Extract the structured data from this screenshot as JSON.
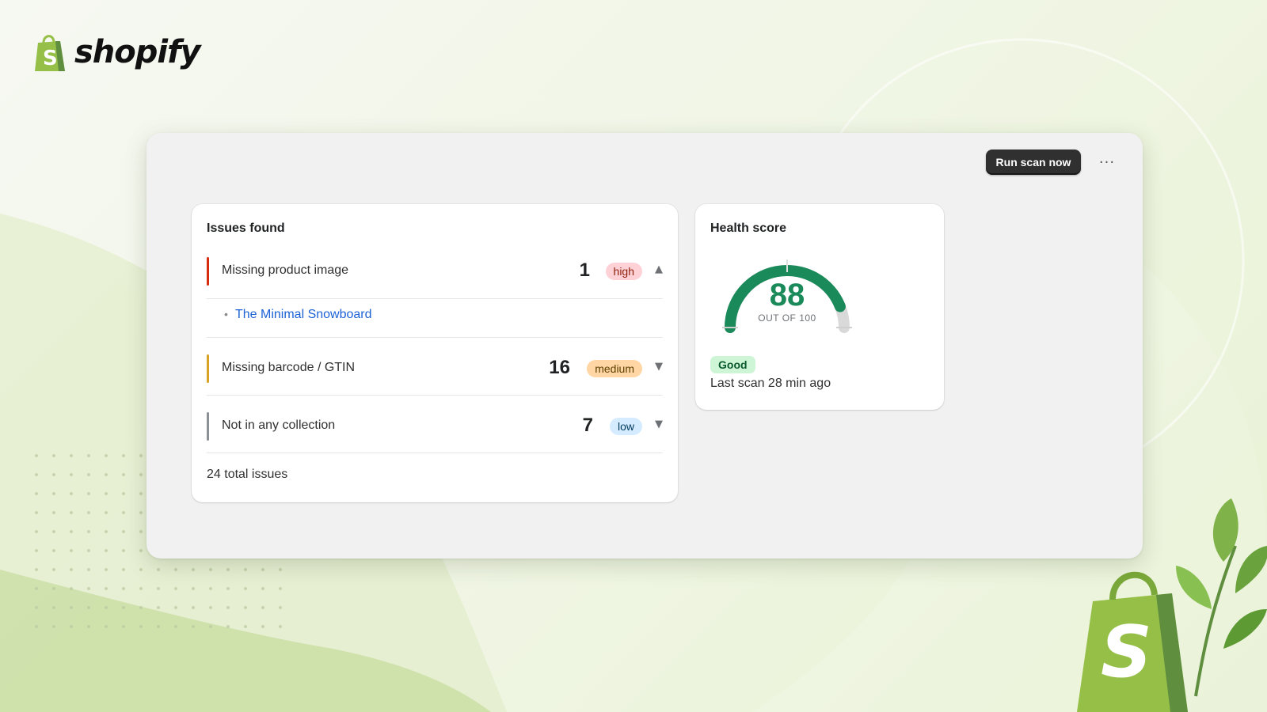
{
  "brand": {
    "name": "shopify",
    "green": "#95bf47",
    "dark_green": "#5e8e3e"
  },
  "toolbar": {
    "run_scan_label": "Run scan now",
    "more_label": "···"
  },
  "issues": {
    "title": "Issues found",
    "items": [
      {
        "label": "Missing product image",
        "count": "1",
        "severity": "high",
        "color": "#d72c0d",
        "expanded": true,
        "chevron": "▲",
        "products": [
          "The Minimal Snowboard"
        ]
      },
      {
        "label": "Missing barcode / GTIN",
        "count": "16",
        "severity": "medium",
        "color": "#d8a223",
        "expanded": false,
        "chevron": "▼"
      },
      {
        "label": "Not in any collection",
        "count": "7",
        "severity": "low",
        "color": "#8c9196",
        "expanded": false,
        "chevron": "▼"
      }
    ],
    "total": "24 total issues"
  },
  "health": {
    "title": "Health score",
    "score": 88,
    "score_text": "88",
    "max": 100,
    "out_of": "OUT OF 100",
    "status": "Good",
    "last_scan": "Last scan 28 min ago",
    "gauge_color": "#1a8a5a",
    "track_color": "#d9d9d9"
  },
  "severity_styles": {
    "high": {
      "bg": "#fed1d7",
      "fg": "#8e1f0b"
    },
    "medium": {
      "bg": "#ffd6a4",
      "fg": "#5e4200"
    },
    "low": {
      "bg": "#d5ebff",
      "fg": "#003a5a"
    }
  }
}
